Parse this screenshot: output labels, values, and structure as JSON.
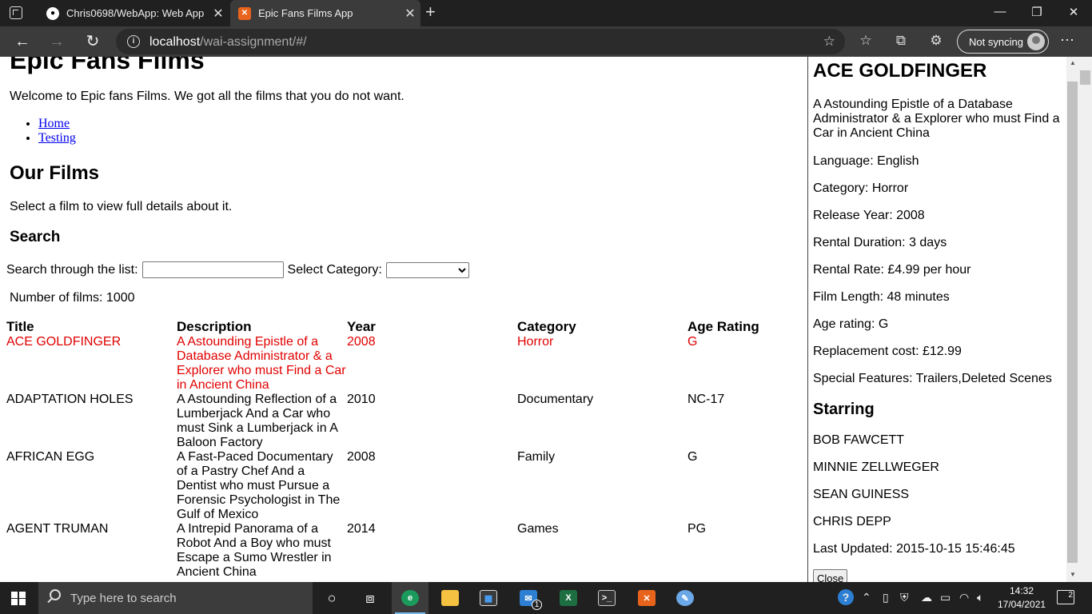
{
  "browser": {
    "tabs": [
      {
        "title": "Chris0698/WebApp: Web App",
        "active": false,
        "icon": "github-icon"
      },
      {
        "title": "Epic Fans Films App",
        "active": true,
        "icon": "xampp-icon"
      }
    ],
    "url_host": "localhost",
    "url_path": "/wai-assignment/#/",
    "sync_label": "Not syncing"
  },
  "page": {
    "site_title": "Epic Fans Films",
    "welcome": "Welcome to Epic fans Films. We got all the films that you do not want.",
    "nav": [
      "Home",
      "Testing"
    ],
    "films_heading": "Our Films",
    "select_hint": "Select a film to view full details about it.",
    "search_heading": "Search",
    "search_label": "Search through the list:",
    "search_value": "",
    "category_label": "Select Category:",
    "category_value": "",
    "film_count": "Number of films: 1000",
    "columns": [
      "Title",
      "Description",
      "Year",
      "Category",
      "Age Rating"
    ],
    "films": [
      {
        "title": "ACE GOLDFINGER",
        "description": "A Astounding Epistle of a Database Administrator & a Explorer who must Find a Car in Ancient China",
        "year": "2008",
        "category": "Horror",
        "rating": "G",
        "selected": true
      },
      {
        "title": "ADAPTATION HOLES",
        "description": "A Astounding Reflection of a Lumberjack And a Car who must Sink a Lumberjack in A Baloon Factory",
        "year": "2010",
        "category": "Documentary",
        "rating": "NC-17",
        "selected": false
      },
      {
        "title": "AFRICAN EGG",
        "description": "A Fast-Paced Documentary of a Pastry Chef And a Dentist who must Pursue a Forensic Psychologist in The Gulf of Mexico",
        "year": "2008",
        "category": "Family",
        "rating": "G",
        "selected": false
      },
      {
        "title": "AGENT TRUMAN",
        "description": "A Intrepid Panorama of a Robot And a Boy who must Escape a Sumo Wrestler in Ancient China",
        "year": "2014",
        "category": "Games",
        "rating": "PG",
        "selected": false
      }
    ]
  },
  "detail": {
    "title": "ACE GOLDFINGER",
    "description": "A Astounding Epistle of a Database Administrator & a Explorer who must Find a Car in Ancient China",
    "fields": [
      "Language: English",
      "Category: Horror",
      "Release Year: 2008",
      "Rental Duration: 3 days",
      "Rental Rate: £4.99 per hour",
      "Film Length: 48 minutes",
      "Age rating: G",
      "Replacement cost: £12.99",
      "Special Features: Trailers,Deleted Scenes"
    ],
    "starring_heading": "Starring",
    "actors": [
      "BOB FAWCETT",
      "MINNIE ZELLWEGER",
      "SEAN GUINESS",
      "CHRIS DEPP"
    ],
    "last_updated": "Last Updated: 2015-10-15 15:46:45",
    "close_label": "Close"
  },
  "taskbar": {
    "search_placeholder": "Type here to search",
    "time": "14:32",
    "date": "17/04/2021",
    "mail_badge": "1",
    "notification_count": "2"
  },
  "colors": {
    "selected_row": "#e00000",
    "link": "#0000ee",
    "chrome_dark": "#202020",
    "chrome_mid": "#3b3b3b"
  }
}
